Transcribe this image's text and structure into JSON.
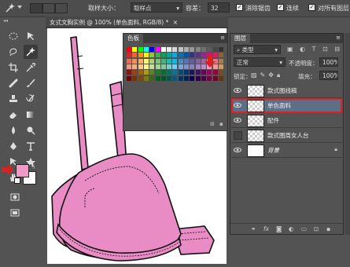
{
  "options_bar": {
    "sample_size_label": "取样大小：",
    "sample_size_value": "取样点",
    "tolerance_label": "容差：",
    "tolerance_value": "32",
    "anti_alias_label": "消除锯齿",
    "contiguous_label": "连续",
    "sample_all_label": "对所有图层"
  },
  "document": {
    "tab_title": "女式文胸实例 @ 100% (单色面料, RGB/8) *",
    "close_glyph": "×"
  },
  "swatches_panel": {
    "tab_label": "色板",
    "colors": [
      "#ff0000",
      "#ffff00",
      "#00ff00",
      "#00ffff",
      "#0000ff",
      "#ff00ff",
      "#ffffff",
      "#ebebeb",
      "#d6d6d6",
      "#c2c2c2",
      "#adadad",
      "#999999",
      "#858585",
      "#707070",
      "#5c5c5c",
      "#474747",
      "#333333",
      "#ed1c24",
      "#f26522",
      "#f7941d",
      "#fff200",
      "#8dc63f",
      "#39b54a",
      "#00a651",
      "#00a99d",
      "#00aeef",
      "#0072bc",
      "#0054a6",
      "#2e3192",
      "#662d91",
      "#92278f",
      "#ec008c",
      "#ed145b",
      "#8c6239",
      "#f26c4f",
      "#f68e56",
      "#fbaf5d",
      "#fff568",
      "#acd373",
      "#7cc576",
      "#3cb878",
      "#1abbb4",
      "#00bff3",
      "#448ccb",
      "#5574b9",
      "#605ca8",
      "#8560a8",
      "#a864a8",
      "#f06eaa",
      "#f26d7d",
      "#a67c52",
      "#f7977a",
      "#f9ad81",
      "#fdc68a",
      "#fff79a",
      "#c4df9b",
      "#a3d39c",
      "#82ca9d",
      "#7accc8",
      "#6dcff6",
      "#7da7d9",
      "#8393ca",
      "#8781bd",
      "#a187be",
      "#bc8dbf",
      "#f49ac2",
      "#f5989d",
      "#c69c6d",
      "#9e0b0f",
      "#a0410d",
      "#a36209",
      "#aba000",
      "#598527",
      "#1a7b30",
      "#007236",
      "#00746b",
      "#0076a3",
      "#004b80",
      "#003471",
      "#1b1464",
      "#440e62",
      "#630460",
      "#9e005d",
      "#9e0039",
      "#754c24",
      "#790000",
      "#7b2e00",
      "#7d4900",
      "#827b00",
      "#406618",
      "#005e20",
      "#005826",
      "#005952",
      "#005b7f",
      "#003663",
      "#002157",
      "#0d004c",
      "#32004b",
      "#4b0049",
      "#7b0046",
      "#7a0026",
      "#603913"
    ],
    "arrow_color": "#e02020"
  },
  "layers_panel": {
    "tab_label": "图层",
    "kind_filter": "类型",
    "blend_mode": "正常",
    "opacity_label": "不透明度：",
    "opacity_value": "100%",
    "lock_label": "锁定：",
    "fill_label": "填充：",
    "fill_value": "100%",
    "layers": [
      {
        "name": "款式图线稿",
        "visible": true,
        "active": false
      },
      {
        "name": "单色面料",
        "visible": true,
        "active": true
      },
      {
        "name": "配件",
        "visible": true,
        "active": false
      },
      {
        "name": "款式图周女人台",
        "visible": false,
        "active": false
      },
      {
        "name": "背景",
        "visible": true,
        "active": false,
        "locked": true
      }
    ],
    "footer_icons": [
      "link-icon",
      "fx-icon",
      "mask-icon",
      "adjustment-icon",
      "group-icon",
      "new-layer-icon",
      "trash-icon"
    ]
  },
  "colors": {
    "foreground": "#f29ac6",
    "background": "#ffffff",
    "fabric_pink": "#e98bc4",
    "highlight_red": "#e02020",
    "selected_layer": "#5d6f86"
  }
}
